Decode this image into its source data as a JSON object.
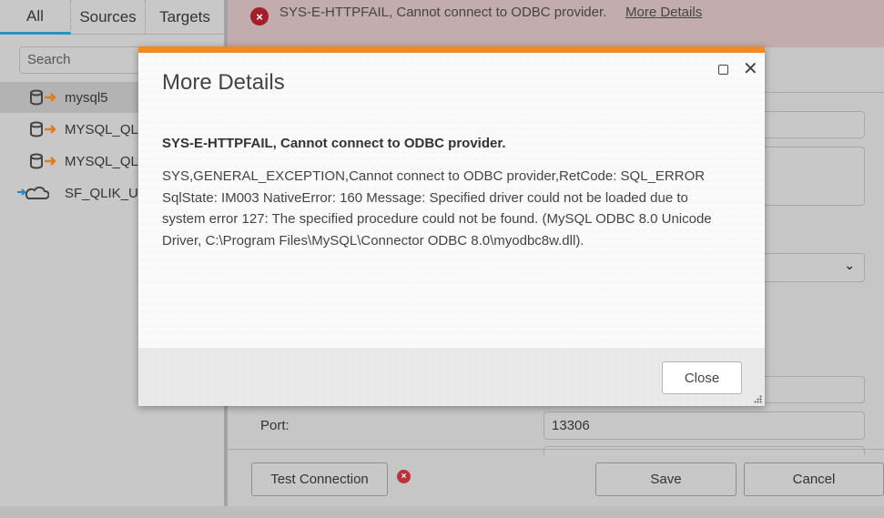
{
  "sidebar": {
    "tabs": [
      {
        "label": "All",
        "active": true
      },
      {
        "label": "Sources",
        "active": false
      },
      {
        "label": "Targets",
        "active": false
      }
    ],
    "search_placeholder": "Search",
    "items": [
      {
        "label": "mysql5",
        "icon": "database-source-icon",
        "selected": true
      },
      {
        "label": "MYSQL_QLI",
        "icon": "database-source-icon",
        "selected": false
      },
      {
        "label": "MYSQL_QLI",
        "icon": "database-source-icon",
        "selected": false
      },
      {
        "label": "SF_QLIK_US",
        "icon": "cloud-target-icon",
        "selected": false
      }
    ]
  },
  "banner": {
    "message": "SYS-E-HTTPFAIL, Cannot connect to ODBC provider.",
    "link": "More Details",
    "color": "#a31f2c"
  },
  "form": {
    "port_label": "Port:",
    "port_value": "13306"
  },
  "footer": {
    "test_connection": "Test Connection",
    "save": "Save",
    "cancel": "Cancel"
  },
  "modal": {
    "title": "More Details",
    "heading": "SYS-E-HTTPFAIL, Cannot connect to ODBC provider.",
    "body": "SYS,GENERAL_EXCEPTION,Cannot connect to ODBC provider,RetCode: SQL_ERROR SqlState: IM003 NativeError: 160 Message: Specified driver could not be loaded due to system error 127: The specified procedure could not be found. (MySQL ODBC 8.0 Unicode Driver, C:\\Program Files\\MySQL\\Connector ODBC 8.0\\myodbc8w.dll).",
    "close_label": "Close",
    "accent": "#f38a21"
  },
  "icons": {
    "error": "×",
    "close": "✕"
  }
}
